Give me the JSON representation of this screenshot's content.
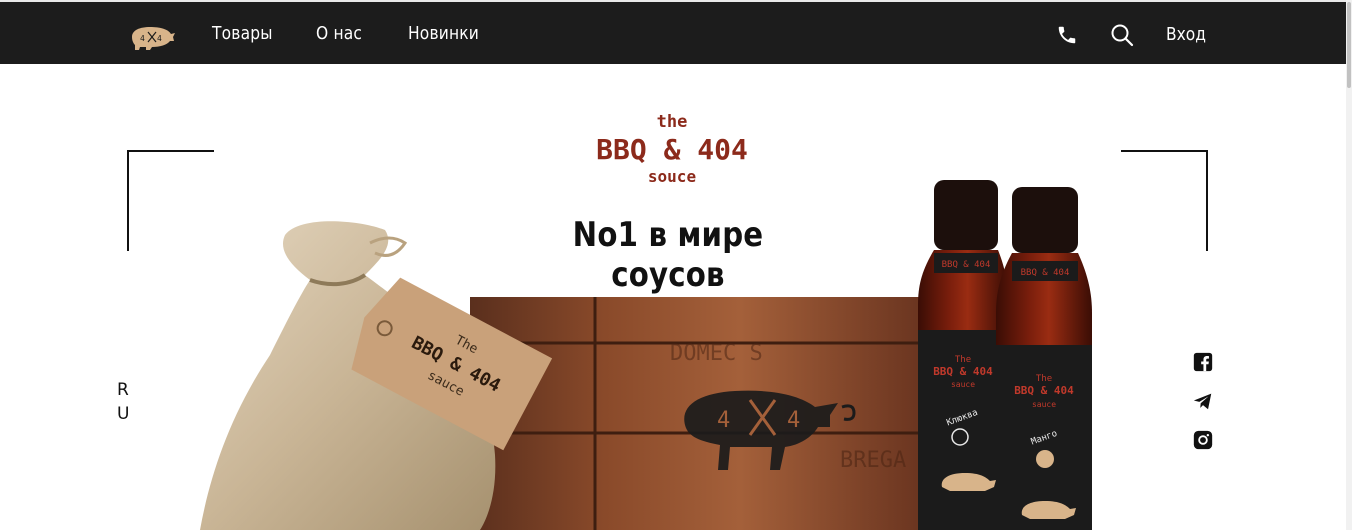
{
  "header": {
    "nav": [
      {
        "label": "Товары"
      },
      {
        "label": "О нас"
      },
      {
        "label": "Новинки"
      }
    ],
    "login": "Вход",
    "icons": [
      "logo-pig-icon",
      "phone-icon",
      "search-icon"
    ]
  },
  "hero": {
    "brand_the": "the",
    "brand_name": "BBQ & 404",
    "brand_souce": "souce",
    "title": "No1 в мире соусов",
    "brand_color": "#8c2a1b",
    "sack_tag": {
      "line1": "The",
      "line2": "BBQ & 404",
      "line3": "sauce"
    },
    "crate_logo": "4  4",
    "bottle_left": {
      "top": "BBQ & 404",
      "the": "The",
      "name": "BBQ & 404",
      "sauce": "sauce",
      "flavor": "Клюква"
    },
    "bottle_right": {
      "top": "BBQ & 404",
      "the": "The",
      "name": "BBQ & 404",
      "sauce": "sauce",
      "flavor": "Манго"
    }
  },
  "lang": {
    "letter1": "R",
    "letter2": "U"
  },
  "social": [
    "facebook-icon",
    "telegram-icon",
    "instagram-icon"
  ]
}
